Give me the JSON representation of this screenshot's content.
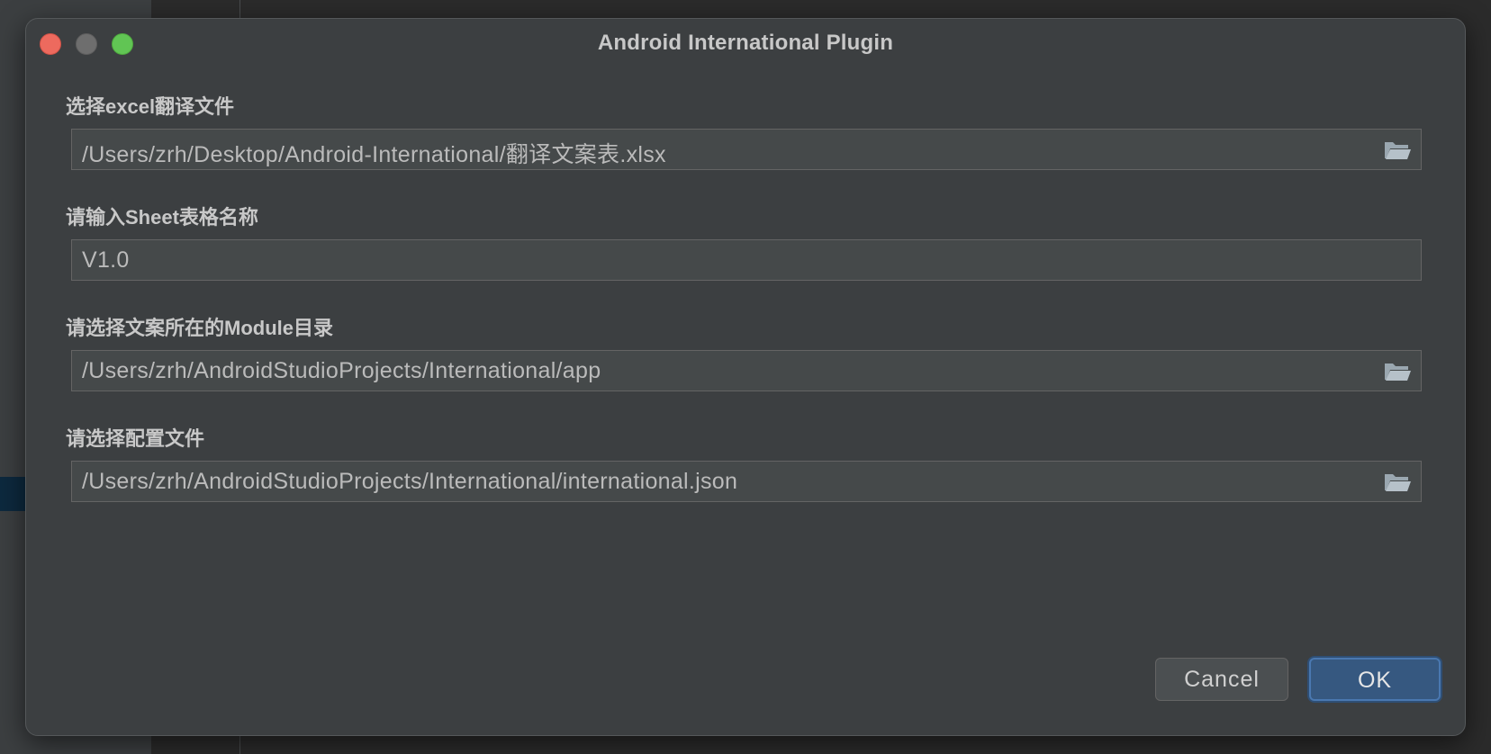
{
  "window": {
    "title": "Android International Plugin"
  },
  "form": {
    "excel": {
      "label": "选择excel翻译文件",
      "value": "/Users/zrh/Desktop/Android-International/翻译文案表.xlsx",
      "icon": "folder-open-icon"
    },
    "sheet": {
      "label": "请输入Sheet表格名称",
      "value": "V1.0"
    },
    "module": {
      "label": "请选择文案所在的Module目录",
      "value": "/Users/zrh/AndroidStudioProjects/International/app",
      "icon": "folder-open-icon"
    },
    "config": {
      "label": "请选择配置文件",
      "value": "/Users/zrh/AndroidStudioProjects/International/international.json",
      "icon": "folder-open-icon"
    }
  },
  "buttons": {
    "cancel": "Cancel",
    "ok": "OK"
  },
  "colors": {
    "dialog_bg": "#3c3f41",
    "field_bg": "#45494a",
    "accent": "#365880",
    "close": "#ed6a5e",
    "minimize": "#6e6e6e",
    "maximize": "#61c554"
  }
}
